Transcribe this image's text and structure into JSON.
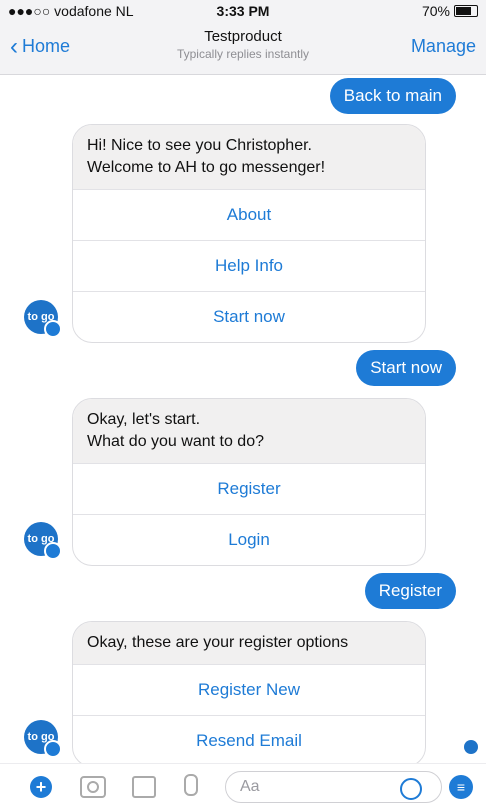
{
  "status_bar": {
    "carrier": "●●●○○ vodafone NL",
    "time": "3:33 PM",
    "battery": "70%"
  },
  "nav": {
    "back_label": "Home",
    "title": "Testproduct",
    "subtitle": "Typically replies instantly",
    "manage_label": "Manage"
  },
  "messages": {
    "out_back_to_main": "Back to main",
    "card1": {
      "text_line1": "Hi! Nice to see you Christopher.",
      "text_line2": "Welcome to AH to go messenger!",
      "buttons": [
        "About",
        "Help Info",
        "Start now"
      ]
    },
    "out_start_now": "Start now",
    "card2": {
      "text_line1": "Okay, let's start.",
      "text_line2": "What do you want to do?",
      "buttons": [
        "Register",
        "Login"
      ]
    },
    "out_register": "Register",
    "card3": {
      "text_line1": "Okay, these are your register options",
      "buttons": [
        "Register New",
        "Resend Email"
      ]
    }
  },
  "composer": {
    "placeholder": "Aa"
  },
  "icons": [
    "plus-icon",
    "camera-icon",
    "image-icon",
    "microphone-icon",
    "emoji-icon",
    "menu-icon",
    "chevron-left-icon",
    "battery-icon",
    "wifi-icon"
  ],
  "colors": {
    "accent": "#1e7bd6",
    "bot_bubble": "#f1f0f0"
  }
}
